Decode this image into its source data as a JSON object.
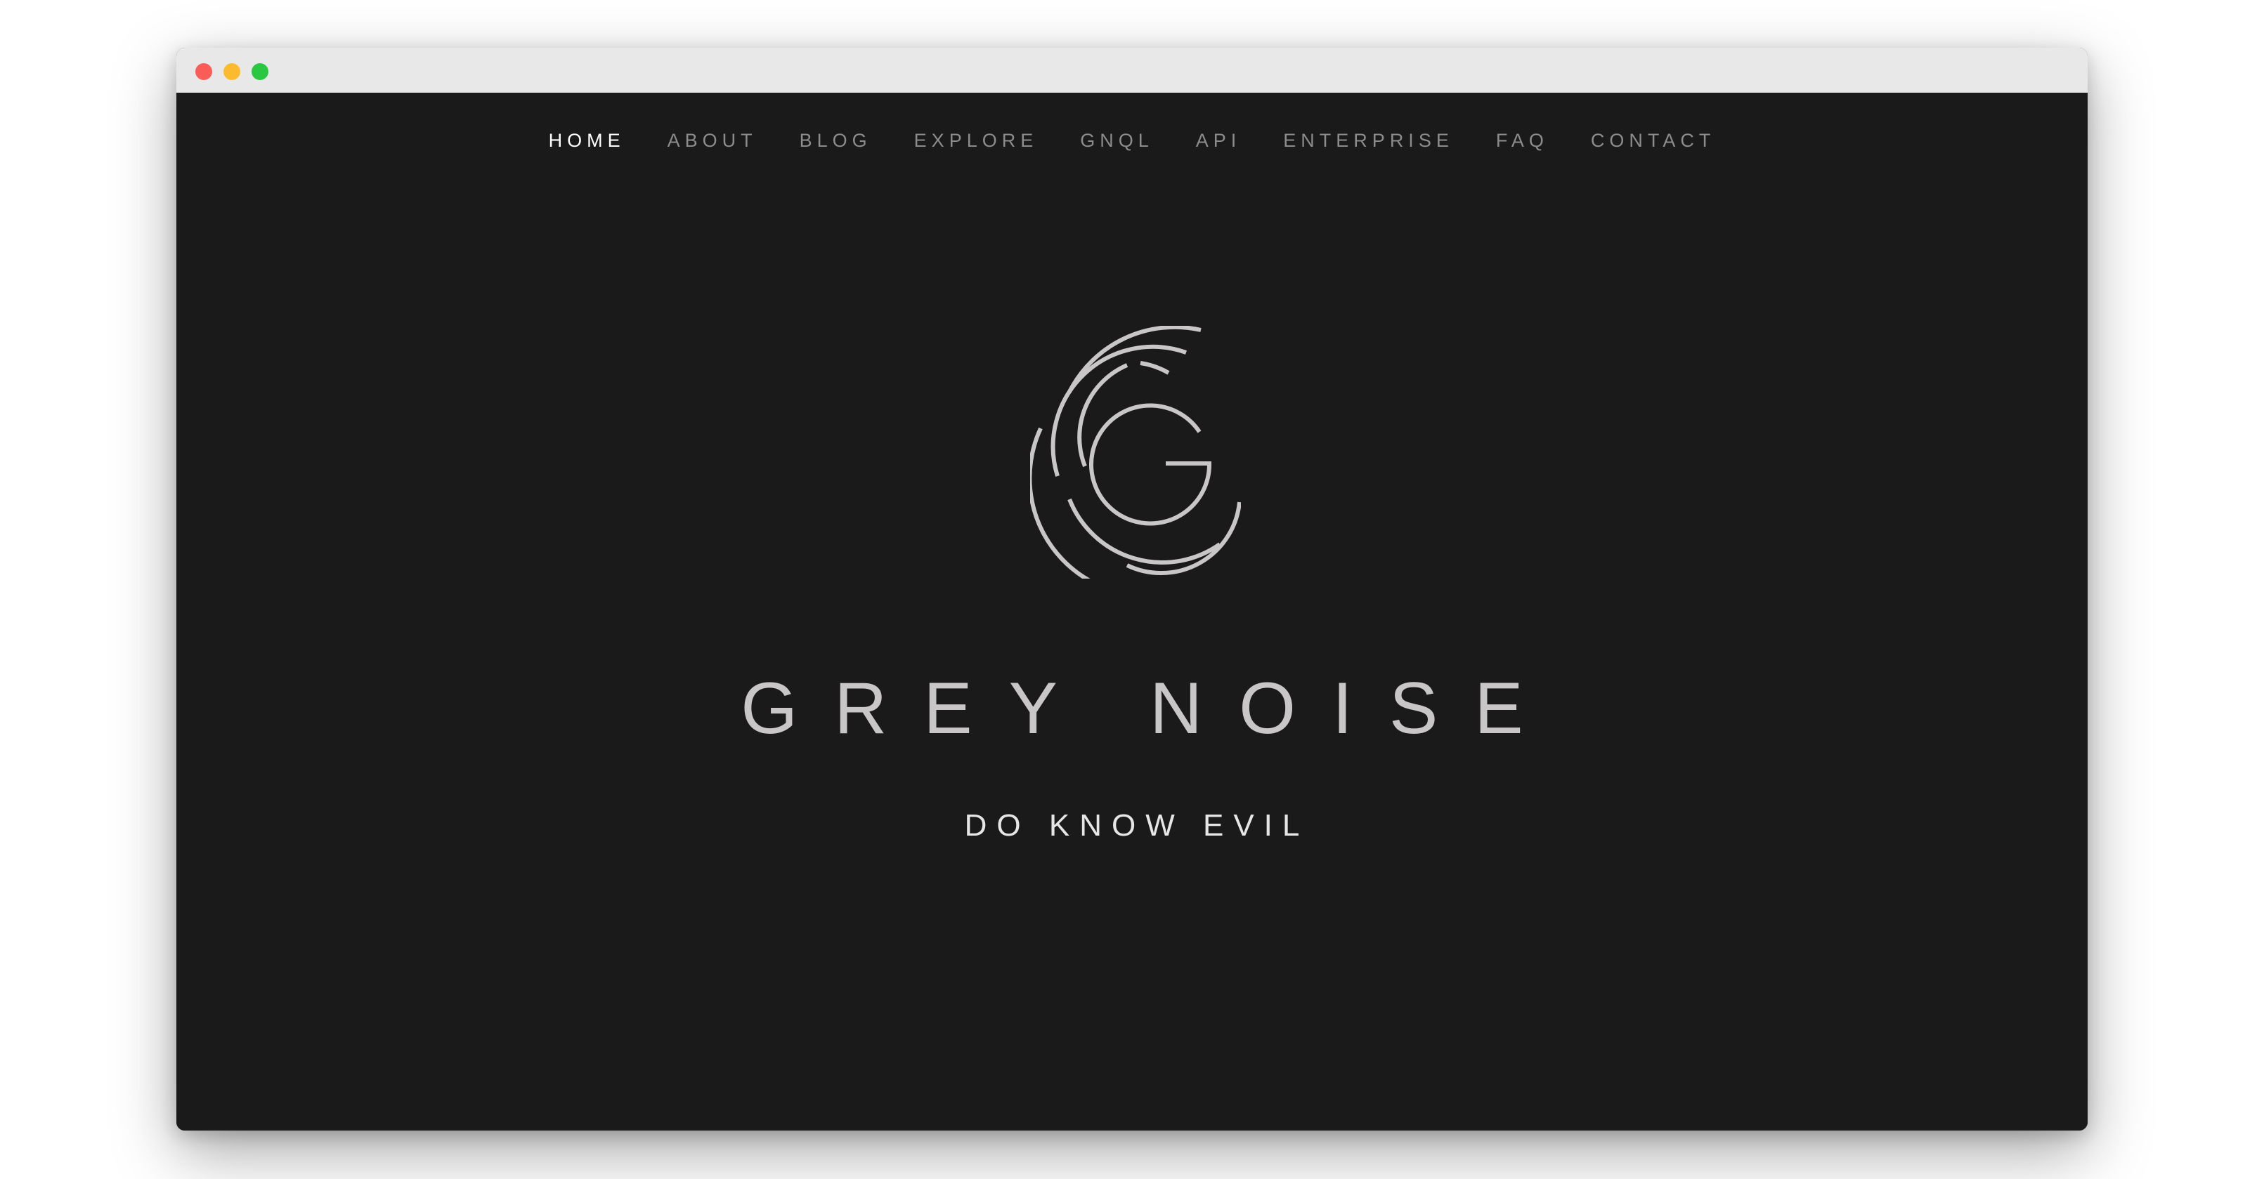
{
  "window": {
    "controls": [
      "close",
      "minimize",
      "zoom"
    ]
  },
  "nav": {
    "items": [
      {
        "label": "HOME",
        "active": true
      },
      {
        "label": "ABOUT",
        "active": false
      },
      {
        "label": "BLOG",
        "active": false
      },
      {
        "label": "EXPLORE",
        "active": false
      },
      {
        "label": "GNQL",
        "active": false
      },
      {
        "label": "API",
        "active": false
      },
      {
        "label": "ENTERPRISE",
        "active": false
      },
      {
        "label": "FAQ",
        "active": false
      },
      {
        "label": "CONTACT",
        "active": false
      }
    ]
  },
  "hero": {
    "logo_icon": "greynoise-g-rings-icon",
    "brand_name": "GREY NOISE",
    "tagline": "DO KNOW EVIL"
  },
  "colors": {
    "background": "#1b1a1b",
    "nav_text": "#8c8c8c",
    "nav_active": "#ffffff",
    "logo": "#c9c6c7",
    "tagline": "#e6e6e6"
  }
}
